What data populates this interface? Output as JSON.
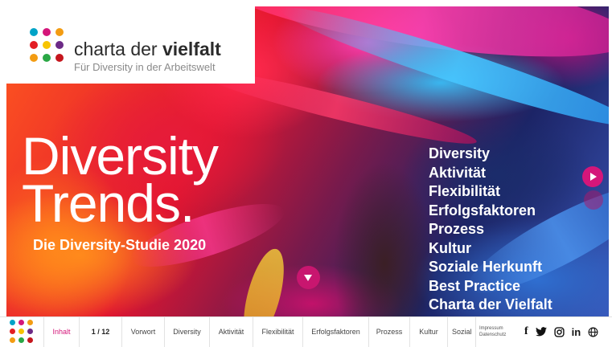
{
  "logo": {
    "title_regular": "charta der ",
    "title_bold": "vielfalt",
    "subtitle": "Für Diversity in der Arbeitswelt",
    "dot_colors": [
      "#00a3c7",
      "#d4167a",
      "#f39c12",
      "#e31e24",
      "#f7c400",
      "#6c2a86",
      "#f39c12",
      "#2aa745",
      "#c5161d"
    ]
  },
  "hero": {
    "title_line1": "Diversity",
    "title_line2": "Trends.",
    "subtitle": "Die Diversity-Studie 2020"
  },
  "toc": [
    "Diversity",
    "Aktivität",
    "Flexibilität",
    "Erfolgsfaktoren",
    "Prozess",
    "Kultur",
    "Soziale Herkunft",
    "Best Practice",
    "Charta der Vielfalt"
  ],
  "bottom_nav": {
    "inhalt": "Inhalt",
    "page": "1 / 12",
    "items": [
      "Vorwort",
      "Diversity",
      "Aktivität",
      "Flexibilität",
      "Erfolgsfaktoren",
      "Prozess",
      "Kultur",
      "Sozial"
    ],
    "impressum": "Impressum",
    "datenschutz": "Datenschutz",
    "social": [
      "facebook-icon",
      "twitter-icon",
      "instagram-icon",
      "linkedin-icon",
      "globe-icon"
    ]
  },
  "colors": {
    "accent": "#d4167a"
  }
}
